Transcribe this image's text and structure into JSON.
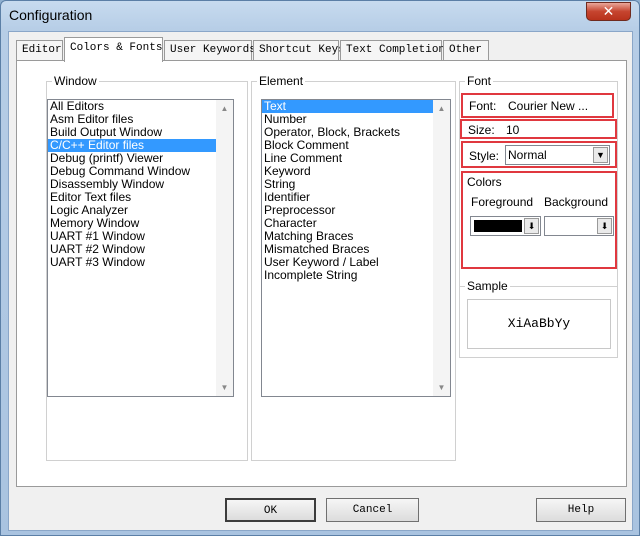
{
  "window": {
    "title": "Configuration",
    "close_glyph": "✕"
  },
  "tabs": [
    {
      "label": "Editor"
    },
    {
      "label": "Colors & Fonts",
      "active": true
    },
    {
      "label": "User Keywords"
    },
    {
      "label": "Shortcut Keys"
    },
    {
      "label": "Text Completion"
    },
    {
      "label": "Other"
    }
  ],
  "window_group": {
    "label": "Window",
    "items": [
      "All Editors",
      "Asm Editor files",
      "Build Output Window",
      "C/C++ Editor files",
      "Debug (printf) Viewer",
      "Debug Command Window",
      "Disassembly Window",
      "Editor Text files",
      "Logic Analyzer",
      "Memory Window",
      "UART #1 Window",
      "UART #2 Window",
      "UART #3 Window"
    ],
    "selected": "C/C++ Editor files"
  },
  "element_group": {
    "label": "Element",
    "items": [
      "Text",
      "Number",
      "Operator, Block, Brackets",
      "Block Comment",
      "Line Comment",
      "Keyword",
      "String",
      "Identifier",
      "Preprocessor",
      "Character",
      "Matching Braces",
      "Mismatched Braces",
      "User Keyword / Label",
      "Incomplete String"
    ],
    "selected": "Text"
  },
  "font_group": {
    "label": "Font",
    "font_label": "Font:",
    "font_value": "Courier New ...",
    "size_label": "Size:",
    "size_value": "10",
    "style_label": "Style:",
    "style_value": "Normal"
  },
  "colors_group": {
    "label": "Colors",
    "foreground_label": "Foreground",
    "background_label": "Background",
    "foreground_color": "#000000",
    "background_color": "#ffffff"
  },
  "sample": {
    "label": "Sample",
    "text": "XiAaBbYy"
  },
  "buttons": {
    "ok": "OK",
    "cancel": "Cancel",
    "help": "Help"
  },
  "colors": {
    "highlight": "#3399ff",
    "annotation_red": "#e0383f"
  }
}
